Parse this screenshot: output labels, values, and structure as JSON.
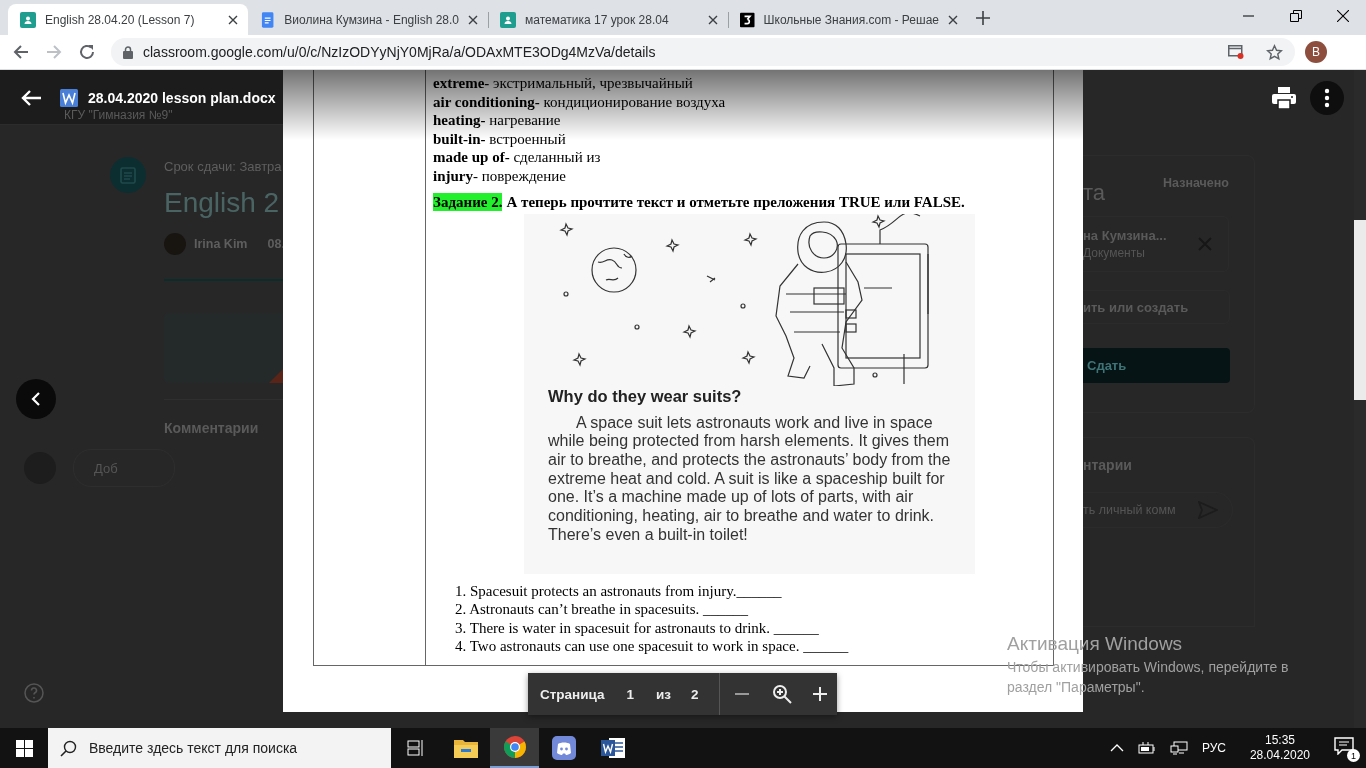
{
  "browser": {
    "tabs": [
      {
        "title": "English 28.04.20 (Lesson 7)",
        "kind": "classroom",
        "selected": true
      },
      {
        "title": "Виолина Кумзина - English 28.0",
        "kind": "docs",
        "selected": false
      },
      {
        "title": "математика 17 урок 28.04",
        "kind": "classroom",
        "selected": false
      },
      {
        "title": "Школьные Знания.com - Решае",
        "kind": "znanija",
        "selected": false
      }
    ],
    "forward_disabled": true,
    "url": "classroom.google.com/u/0/c/NzIzODYyNjY0MjRa/a/ODAxMTE3ODg4MzVa/details",
    "profile_initial": "В"
  },
  "viewer": {
    "file_name": "28.04.2020 lesson plan.docx"
  },
  "background_page": {
    "header_subtitle": "КГУ \"Гимназия №9\"",
    "due": "Срок сдачи: Завтра",
    "title": "English 2",
    "author": "Irina Kim",
    "date": "08.",
    "comments_heading": "Комментарии",
    "comment_placeholder": "Доб",
    "work_card": {
      "heading": "та",
      "status": "Назначено",
      "attachment_title": "на Кумзина...",
      "attachment_type": "Документы",
      "add_button": "ить или создать",
      "submit_button": "Сдать"
    },
    "private_comments": {
      "heading": "нтарии",
      "placeholder": "ть личный комм"
    }
  },
  "document": {
    "vocabulary": [
      "**extreme-** экстримальный, чрезвычайный",
      "**air conditioning-** кондиционирование воздуха",
      "**heating-** нагревание",
      "**built-in-** встроенный",
      "**made up of-** сделанный из",
      "**injury**- повреждение"
    ],
    "task": {
      "label": "Задание 2.",
      "instruction": "А теперь прочтите текст и отметьте преложения TRUE или FALSE."
    },
    "illustration": {
      "heading": "Why do they wear suits?",
      "paragraph": "A space suit lets astronauts work and live in space while being protected from harsh elements. It gives them air to breathe, and protects the astronauts’ body from the extreme heat and cold. A suit is like a spaceship built for one. It’s a machine made up of lots of parts, with air conditioning, heating, air to breathe and water to drink. There’s even a built-in toilet!"
    },
    "questions": [
      "1. Spacesuit protects an astronauts from injury.______",
      "2. Astronauts can’t breathe in spacesuits. ______",
      "3. There is water in spacesuit for astronauts to drink. ______",
      "4. Two astronauts can use one spacesuit to work in space. ______"
    ]
  },
  "pager": {
    "label": "Страница",
    "page": "1",
    "of": "из",
    "total": "2"
  },
  "activation_notice": {
    "title": "Активация Windows",
    "text": "Чтобы активировать Windows, перейдите в раздел \"Параметры\"."
  },
  "taskbar": {
    "search_placeholder": "Введите здесь текст для поиска",
    "apps": [
      {
        "kind": "explorer",
        "selected": false
      },
      {
        "kind": "chrome",
        "selected": true
      },
      {
        "kind": "discord",
        "selected": false
      },
      {
        "kind": "word",
        "selected": false
      }
    ],
    "language": "РУС",
    "time": "15:35",
    "date": "28.04.2020",
    "notifications": "1"
  }
}
